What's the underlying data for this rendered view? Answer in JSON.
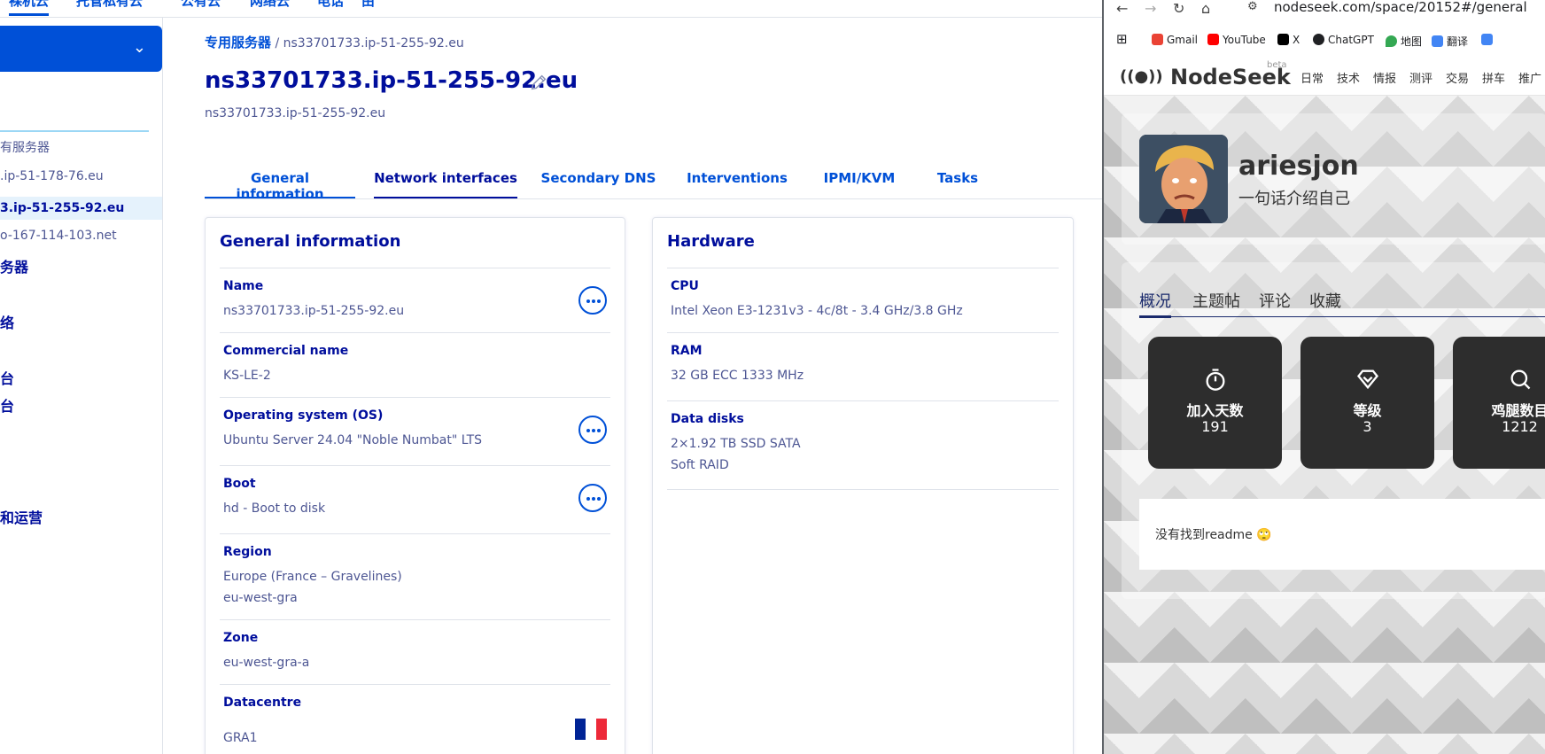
{
  "topnav": {
    "items": [
      "裸机云",
      "托管私有云",
      "公有云",
      "网络云",
      "电话",
      "由"
    ]
  },
  "sidebar": {
    "items": [
      {
        "label": "有服务器",
        "style": "normal"
      },
      {
        "label": ".ip-51-178-76.eu",
        "style": "normal"
      },
      {
        "label": "3.ip-51-255-92.eu",
        "style": "active"
      },
      {
        "label": "o-167-114-103.net",
        "style": "normal"
      },
      {
        "label": "务器",
        "style": "bold"
      },
      {
        "label": "络",
        "style": "bold"
      },
      {
        "label": "台",
        "style": "bold"
      },
      {
        "label": "台",
        "style": "bold"
      },
      {
        "label": "和运营",
        "style": "bold"
      }
    ]
  },
  "page": {
    "breadcrumb_link": "专用服务器",
    "breadcrumb_sep": "/",
    "breadcrumb_current": "ns33701733.ip-51-255-92.eu",
    "title": "ns33701733.ip-51-255-92.eu",
    "subtitle": "ns33701733.ip-51-255-92.eu"
  },
  "tabs": [
    "General information",
    "Network interfaces",
    "Secondary DNS",
    "Interventions",
    "IPMI/KVM",
    "Tasks"
  ],
  "general": {
    "title": "General information",
    "rows": [
      {
        "label": "Name",
        "values": [
          "ns33701733.ip-51-255-92.eu"
        ]
      },
      {
        "label": "Commercial name",
        "values": [
          "KS-LE-2"
        ]
      },
      {
        "label": "Operating system (OS)",
        "values": [
          "Ubuntu Server 24.04 \"Noble Numbat\" LTS"
        ]
      },
      {
        "label": "Boot",
        "values": [
          "hd - Boot to disk"
        ]
      },
      {
        "label": "Region",
        "values": [
          "Europe (France – Gravelines)",
          "eu-west-gra"
        ]
      },
      {
        "label": "Zone",
        "values": [
          "eu-west-gra-a"
        ]
      },
      {
        "label": "Datacentre",
        "values": [
          "GRA1"
        ]
      }
    ]
  },
  "hardware": {
    "title": "Hardware",
    "rows": [
      {
        "label": "CPU",
        "values": [
          "Intel Xeon E3-1231v3 - 4c/8t - 3.4 GHz/3.8 GHz"
        ]
      },
      {
        "label": "RAM",
        "values": [
          "32 GB ECC 1333 MHz"
        ]
      },
      {
        "label": "Data disks",
        "values": [
          "2×1.92 TB SSD SATA",
          "Soft RAID"
        ]
      }
    ]
  },
  "browser": {
    "url": "nodeseek.com/space/20152#/general",
    "bookmarks": [
      {
        "label": "Gmail",
        "color": "#ea4335"
      },
      {
        "label": "YouTube",
        "color": "#ff0000"
      },
      {
        "label": "X",
        "color": "#000000"
      },
      {
        "label": "ChatGPT",
        "color": "#202124"
      },
      {
        "label": "地图",
        "color": "#34a853"
      },
      {
        "label": "翻译",
        "color": "#4285f4"
      }
    ]
  },
  "nodeseek": {
    "logo": "NodeSeek",
    "beta": "beta",
    "nav": [
      "日常",
      "技术",
      "情报",
      "测评",
      "交易",
      "拼车",
      "推广"
    ],
    "username": "ariesjon",
    "bio": "一句话介绍自己",
    "tabs": [
      "概况",
      "主题帖",
      "评论",
      "收藏"
    ],
    "stats": [
      {
        "label": "加入天数",
        "value": "191",
        "icon": "timer-icon"
      },
      {
        "label": "等级",
        "value": "3",
        "icon": "diamond-icon"
      },
      {
        "label": "鸡腿数目",
        "value": "1212",
        "icon": "search-icon"
      }
    ],
    "readme": "没有找到readme 🙄"
  },
  "colors": {
    "ovh_primary": "#0050d7",
    "ovh_title": "#000e9c",
    "ovh_text": "#4d5693",
    "flag_blue": "#002395",
    "flag_white": "#ffffff",
    "flag_red": "#ed2939"
  }
}
